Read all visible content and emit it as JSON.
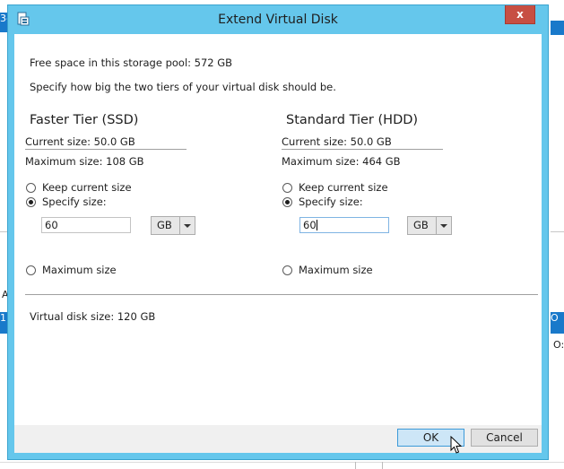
{
  "window": {
    "title": "Extend Virtual Disk",
    "close_label": "x"
  },
  "background": {
    "left_top_label": "3-",
    "left_row_label": "1",
    "right_row_label": "O",
    "right_row2_label": "O:",
    "left_mid_label": "A"
  },
  "pool_info": "Free space in this storage pool: 572 GB",
  "instructions": "Specify how big the two tiers of your virtual disk should be.",
  "tiers": [
    {
      "heading": "Faster Tier (SSD)",
      "current_size": "Current size: 50.0 GB",
      "maximum_size": "Maximum size: 108 GB",
      "keep_label": "Keep current size",
      "specify_label": "Specify size:",
      "size_value": "60",
      "unit": "GB",
      "max_label": "Maximum size",
      "selected_option": "specify"
    },
    {
      "heading": "Standard Tier (HDD)",
      "current_size": "Current size: 50.0 GB",
      "maximum_size": "Maximum size: 464 GB",
      "keep_label": "Keep current size",
      "specify_label": "Specify size:",
      "size_value": "60",
      "unit": "GB",
      "max_label": "Maximum size",
      "selected_option": "specify"
    }
  ],
  "virtual_disk_size": "Virtual disk size: 120 GB",
  "buttons": {
    "ok": "OK",
    "cancel": "Cancel"
  },
  "colors": {
    "title_bar": "#65c7ec",
    "close_button": "#c74f43",
    "ok_button": "#cde6f7",
    "background_accent": "#1979ca"
  }
}
